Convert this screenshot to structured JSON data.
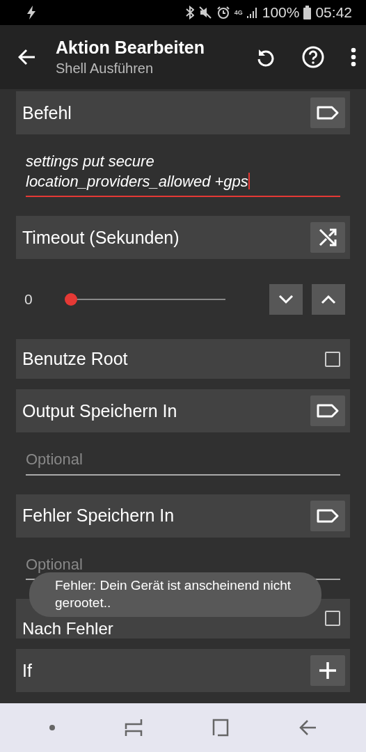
{
  "status_bar": {
    "network": "4G",
    "battery": "100%",
    "time": "05:42"
  },
  "app_bar": {
    "title": "Aktion Bearbeiten",
    "subtitle": "Shell Ausführen"
  },
  "sections": [
    {
      "kind": "tag_header",
      "label": "Befehl"
    },
    {
      "kind": "field",
      "value": "settings put secure location_providers_allowed +gps",
      "focused": true
    },
    {
      "kind": "shuffle_header",
      "label": "Timeout (Sekunden)"
    },
    {
      "kind": "slider",
      "reading": "0",
      "level": 0
    },
    {
      "kind": "checkbox",
      "label": "Benutze Root",
      "checked": false
    },
    {
      "kind": "tag_header",
      "label": "Output Speichern In"
    },
    {
      "kind": "field",
      "placeholder": "Optional",
      "focused": false
    },
    {
      "kind": "tag_header",
      "label": "Fehler Speichern In"
    },
    {
      "kind": "field",
      "placeholder": "Optional",
      "focused": false
    },
    {
      "kind": "checkbox",
      "label": "Nach Fehler",
      "checked": false
    },
    {
      "kind": "add_header",
      "label": "If"
    }
  ],
  "toast": {
    "text": "Fehler: Dein Gerät ist anscheinend nicht gerootet.."
  }
}
